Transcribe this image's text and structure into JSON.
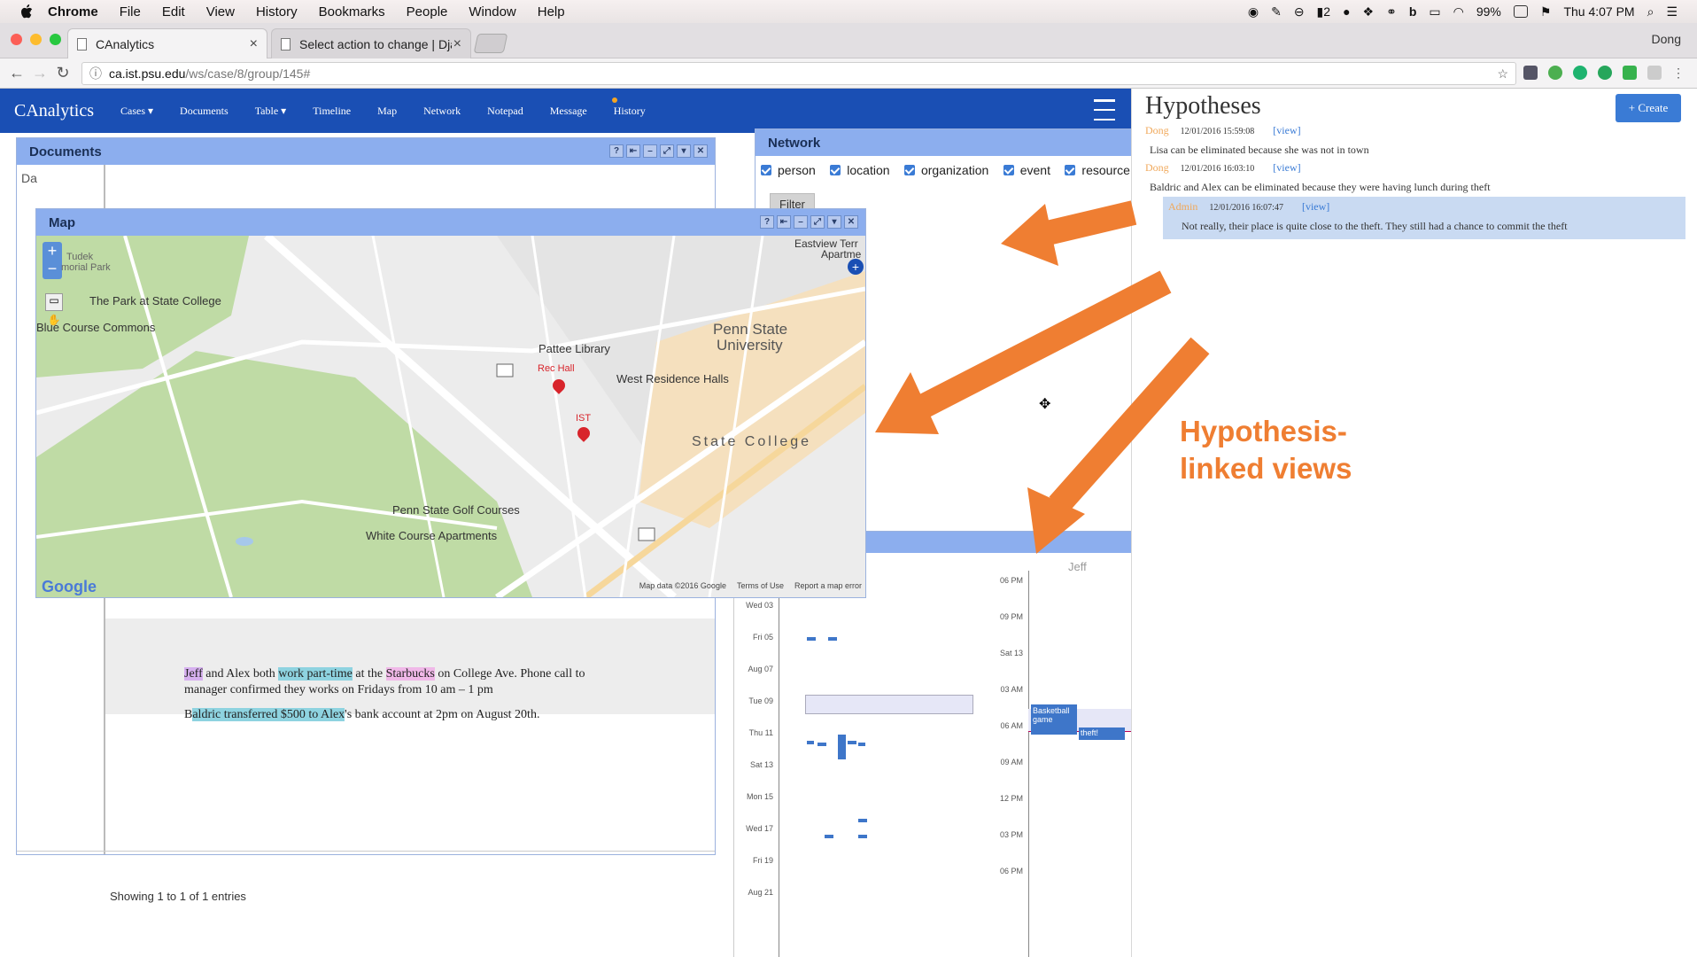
{
  "os_menubar": {
    "app": "Chrome",
    "menus": [
      "File",
      "Edit",
      "View",
      "History",
      "Bookmarks",
      "People",
      "Window",
      "Help"
    ],
    "status": {
      "badge_count": "2",
      "battery": "99%",
      "clock": "Thu 4:07 PM"
    }
  },
  "browser": {
    "tabs": [
      {
        "title": "CAnalytics",
        "active": true
      },
      {
        "title": "Select action to change | Djan",
        "active": false
      }
    ],
    "profile": "Dong",
    "url_host": "ca.ist.psu.edu",
    "url_path": "/ws/case/8/group/145#"
  },
  "app": {
    "brand": "CAnalytics",
    "nav": [
      "Cases ▾",
      "Documents",
      "Table ▾",
      "Timeline",
      "Map",
      "Network",
      "Notepad",
      "Message",
      "History"
    ],
    "filter_tag": "timeline",
    "documents": {
      "title": "Documents",
      "entries_info": "Showing 1 to 1 of 1 entries"
    },
    "doc_text": {
      "line1_a": "Jeff",
      "line1_b": " and Alex both ",
      "line1_c": "work part-time",
      "line1_d": " at the ",
      "line1_e": "Starbucks",
      "line1_f": " on College Ave. Phone call to",
      "line2": "manager confirmed they works on Fridays from 10 am – 1 pm",
      "line3_a": "B",
      "line3_b": "aldric transferred $500 to Alex",
      "line3_c": "'s bank account at 2pm on August 20th."
    },
    "network": {
      "title": "Network",
      "filters": [
        "person",
        "location",
        "organization",
        "event",
        "resource"
      ],
      "filter_button": "Filter"
    },
    "map": {
      "title": "Map",
      "labels": {
        "park": "The Park at State College",
        "commons": "Blue Course Commons",
        "pattee": "Pattee Library",
        "rec": "Rec Hall",
        "ist": "IST",
        "west": "West Residence Halls",
        "psu1": "Penn State",
        "psu2": "University",
        "sc": "State College",
        "golf": "Penn State Golf Courses",
        "white": "White Course Apartments",
        "eastview": "Eastview Terr",
        "apart": "Apartme",
        "tudek": "Tudek",
        "memorial": "morial Park",
        "google": "Google",
        "mapdata": "Map data ©2016 Google",
        "terms": "Terms of Use",
        "report": "Report a map error"
      }
    },
    "timeline": {
      "left_axis": [
        "Wed 03",
        "Fri 05",
        "Aug 07",
        "Tue 09",
        "Thu 11",
        "Sat 13",
        "Mon 15",
        "Wed 17",
        "Fri 19",
        "Aug 21"
      ],
      "right_axis": [
        "06 PM",
        "09 PM",
        "Sat 13",
        "03 AM",
        "06 AM",
        "09 AM",
        "12 PM",
        "03 PM",
        "06 PM"
      ],
      "lane": "Jeff",
      "events": [
        "Basketball game",
        "theft!"
      ]
    },
    "hypotheses": {
      "title": "Hypotheses",
      "create_label": "+ Create",
      "items": [
        {
          "author": "Dong",
          "time": "12/01/2016 15:59:08",
          "view": "[view]",
          "text": "Lisa can be eliminated because she was not in town"
        },
        {
          "author": "Dong",
          "time": "12/01/2016 16:03:10",
          "view": "[view]",
          "text": "Baldric and Alex can be eliminated because they were having lunch during theft"
        },
        {
          "author": "Admin",
          "time": "12/01/2016 16:07:47",
          "view": "[view]",
          "text": "Not really, their place is quite close to the theft. They still had a chance to commit the theft"
        }
      ]
    },
    "annotation": {
      "line1": "Hypothesis-",
      "line2": "linked views"
    },
    "colors": {
      "nav": "#1a4fb4",
      "panel_header": "#8caeee",
      "accent": "#ef7e32",
      "author": "#f0a85a"
    }
  }
}
